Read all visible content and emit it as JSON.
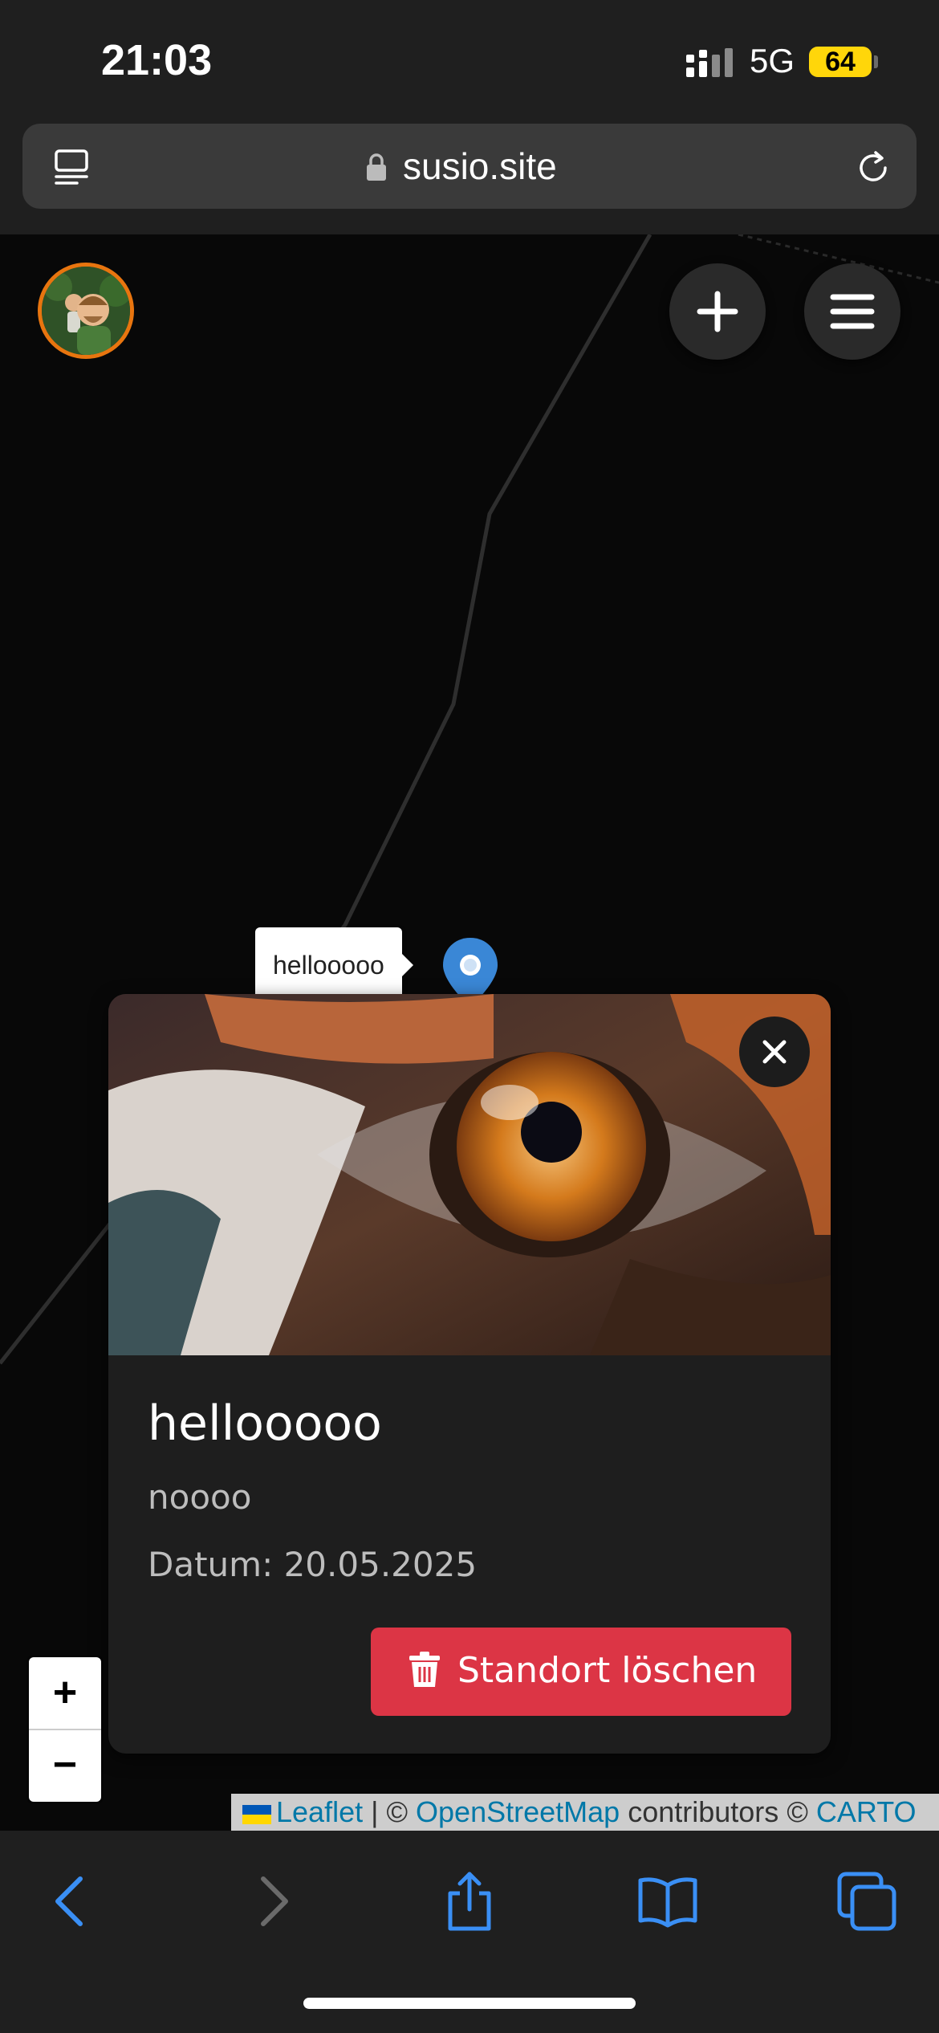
{
  "status_bar": {
    "time": "21:03",
    "network": "5G",
    "battery": "64"
  },
  "browser": {
    "url": "susio.site"
  },
  "map": {
    "marker_tooltip": "hellooooo",
    "zoom_in_label": "+",
    "zoom_out_label": "−"
  },
  "popup": {
    "title": "hellooooo",
    "description": "noooo",
    "date": "Datum: 20.05.2025",
    "delete_label": "Standort löschen",
    "close_label": "×"
  },
  "attribution": {
    "leaflet": "Leaflet",
    "separator": "|",
    "copyright1": "©",
    "osm": "OpenStreetMap",
    "contributors": "contributors",
    "copyright2": "©",
    "carto": "CARTO"
  },
  "colors": {
    "accent_orange": "#e8750f",
    "delete_red": "#dc3545",
    "marker_blue": "#3a87d6",
    "link_blue": "#0078a8",
    "toolbar_blue": "#3a8ff5"
  },
  "icons": {
    "tabs": "sidebar-icon",
    "lock": "lock-icon",
    "reload": "reload-icon",
    "add": "plus-icon",
    "menu": "hamburger-icon",
    "close": "close-icon",
    "delete": "trash-icon",
    "back": "chevron-left-icon",
    "forward": "chevron-right-icon",
    "share": "share-icon",
    "bookmarks": "book-icon",
    "tabs_overview": "tabs-icon"
  }
}
